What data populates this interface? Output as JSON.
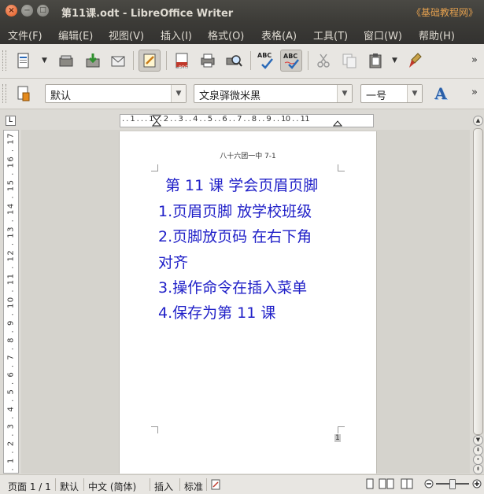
{
  "window": {
    "title": "第11课.odt - LibreOffice Writer",
    "watermark": "《基础教程网》",
    "close_glyph": "×",
    "min_glyph": "−",
    "max_glyph": "□"
  },
  "menu": [
    {
      "label": "文件(F)"
    },
    {
      "label": "编辑(E)"
    },
    {
      "label": "视图(V)"
    },
    {
      "label": "插入(I)"
    },
    {
      "label": "格式(O)"
    },
    {
      "label": "表格(A)"
    },
    {
      "label": "工具(T)"
    },
    {
      "label": "窗口(W)"
    },
    {
      "label": "帮助(H)"
    }
  ],
  "toolbar": {
    "more_glyph": "»",
    "abc_label": "ABC",
    "pdf_label": "PDF",
    "icons": [
      "new-document",
      "open-folder",
      "save",
      "email",
      "edit-mode",
      "export-pdf",
      "print",
      "print-preview",
      "spellcheck",
      "autospellcheck",
      "cut",
      "copy",
      "paste",
      "clone-formatting"
    ]
  },
  "format_bar": {
    "style": "默认",
    "font": "文泉驿微米黑",
    "size": "一号",
    "font_a": "A"
  },
  "ruler": {
    "corner_glyph": "L",
    "horizontal": ". . 1 . . . 1 . . 2 . . 3 . . 4 . . 5 . . 6 . . 7 . . 8 . . 9 . . 10 . . 11",
    "vertical": ". 1 . 2 . 3 . 4 . 5 . 6 . 7 . 8 . 9 . 10 . 11 . 12 . 13 . 14 . 15 . 16 . 17"
  },
  "document": {
    "header": "八十六团一中  7-1",
    "title": "第 11 课  学会页眉页脚",
    "lines": [
      "1.页眉页脚    放学校班级",
      "2.页脚放页码 在右下角",
      "对齐",
      "3.操作命令在插入菜单",
      "4.保存为第 11 课"
    ],
    "footer_mark": "1"
  },
  "status": {
    "page": "页面 1 / 1",
    "style": "默认",
    "language": "中文 (简体)",
    "insert_mode": "插入",
    "selection_mode": "标准"
  },
  "colors": {
    "text_blue": "#2121c8",
    "title_orange": "#e5a14f"
  }
}
